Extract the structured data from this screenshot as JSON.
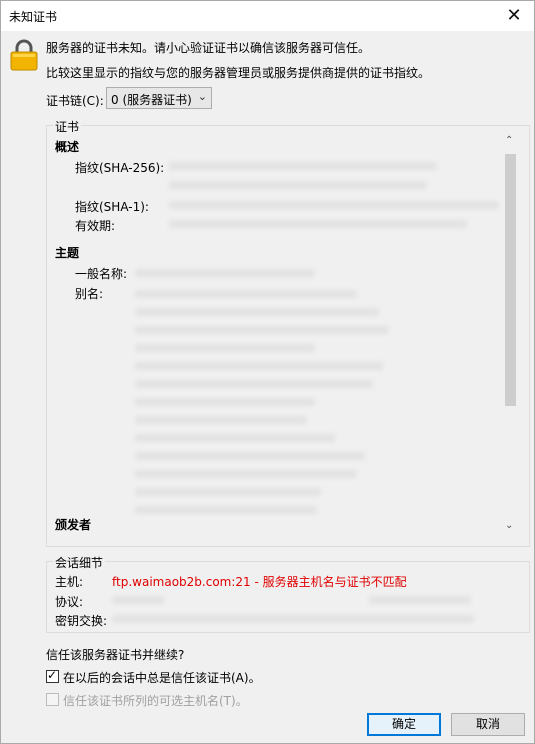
{
  "window": {
    "title": "未知证书",
    "close_glyph": "✕"
  },
  "message": {
    "line1": "服务器的证书未知。请小心验证证书以确信该服务器可信任。",
    "line2": "比较这里显示的指纹与您的服务器管理员或服务提供商提供的证书指纹。"
  },
  "chain": {
    "label": "证书链(C):",
    "selected": "0 (服务器证书)"
  },
  "certificate": {
    "group_label": "证书",
    "overview": {
      "heading": "概述",
      "sha256_label": "指纹(SHA-256):",
      "sha1_label": "指纹(SHA-1):",
      "validity_label": "有效期:"
    },
    "subject": {
      "heading": "主题",
      "common_name_label": "一般名称:",
      "alias_label": "别名:"
    },
    "issuer": {
      "heading": "颁发者"
    }
  },
  "session": {
    "group_label": "会话细节",
    "host_label": "主机:",
    "host_value": "ftp.waimaob2b.com:21 - 服务器主机名与证书不匹配",
    "protocol_label": "协议:",
    "key_exchange_label": "密钥交换:"
  },
  "trust": {
    "question": "信任该服务器证书并继续?",
    "always_trust_label": "在以后的会话中总是信任该证书(A)。",
    "always_trust_checked": true,
    "trust_alt_names_label": "信任该证书所列的可选主机名(T)。",
    "trust_alt_names_enabled": false
  },
  "buttons": {
    "ok": "确定",
    "cancel": "取消"
  },
  "colors": {
    "warning_red": "#e00000",
    "accent": "#0078d7",
    "lock_gold": "#f2b400"
  },
  "icons": {
    "lock": "padlock-warning-icon",
    "scroll_up": "chevron-up-icon",
    "scroll_down": "chevron-down-icon"
  }
}
